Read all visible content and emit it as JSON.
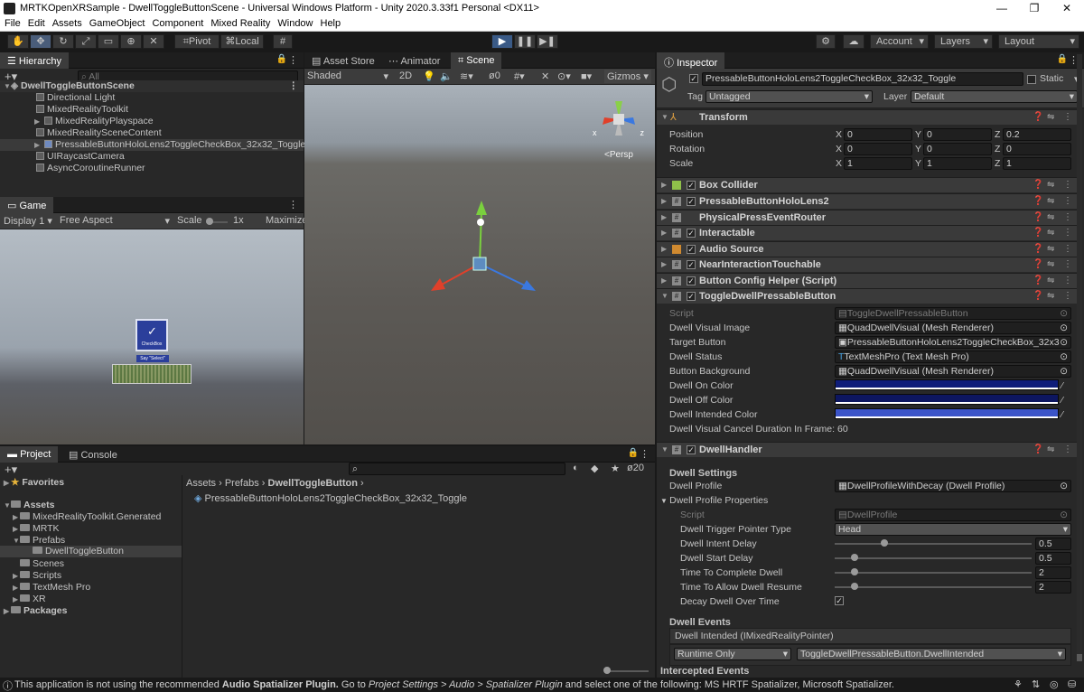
{
  "window": {
    "title": "MRTKOpenXRSample - DwellToggleButtonScene - Universal Windows Platform - Unity 2020.3.33f1 Personal <DX11>",
    "controls": [
      "—",
      "❐",
      "✕"
    ]
  },
  "menu": [
    "File",
    "Edit",
    "Assets",
    "GameObject",
    "Component",
    "Mixed Reality",
    "Window",
    "Help"
  ],
  "toolbar": {
    "pivot": "Pivot",
    "local": "Local",
    "account": "Account",
    "layers": "Layers",
    "layout": "Layout"
  },
  "hierarchy": {
    "tab": "Hierarchy",
    "search_placeholder": "All",
    "scene": "DwellToggleButtonScene",
    "items": [
      "Directional Light",
      "MixedRealityToolkit",
      "MixedRealityPlayspace",
      "MixedRealitySceneContent",
      "PressableButtonHoloLens2ToggleCheckBox_32x32_Toggle",
      "UIRaycastCamera",
      "AsyncCoroutineRunner"
    ]
  },
  "game": {
    "tab": "Game",
    "display": "Display 1",
    "aspect": "Free Aspect",
    "scale_label": "Scale",
    "scale_value": "1x",
    "maximize": "Maximize",
    "button_caption": "CheckBox",
    "say_select": "Say \"Select\""
  },
  "scene": {
    "tabs": [
      "Asset Store",
      "Animator",
      "Scene"
    ],
    "shading": "Shaded",
    "mode_2d": "2D",
    "hidden_count": "0",
    "gizmos": "Gizmos",
    "persp": "<Persp",
    "gizmo_x": "x",
    "gizmo_z": "z"
  },
  "inspector": {
    "tab": "Inspector",
    "object_name": "PressableButtonHoloLens2ToggleCheckBox_32x32_Toggle",
    "static_label": "Static",
    "tag_label": "Tag",
    "tag_value": "Untagged",
    "layer_label": "Layer",
    "layer_value": "Default",
    "transform": {
      "title": "Transform",
      "position_label": "Position",
      "rotation_label": "Rotation",
      "scale_label": "Scale",
      "position": [
        "0",
        "0",
        "0.2"
      ],
      "rotation": [
        "0",
        "0",
        "0"
      ],
      "scale": [
        "1",
        "1",
        "1"
      ],
      "axes": [
        "X",
        "Y",
        "Z"
      ]
    },
    "components": [
      "Box Collider",
      "PressableButtonHoloLens2",
      "PhysicalPressEventRouter",
      "Interactable",
      "Audio Source",
      "NearInteractionTouchable",
      "Button Config Helper (Script)",
      "ToggleDwellPressableButton"
    ],
    "toggle_dwell": {
      "fields": [
        {
          "label": "Script",
          "value": "ToggleDwellPressableButton"
        },
        {
          "label": "Dwell Visual Image",
          "value": "QuadDwellVisual (Mesh Renderer)"
        },
        {
          "label": "Target Button",
          "value": "PressableButtonHoloLens2ToggleCheckBox_32x3"
        },
        {
          "label": "Dwell Status",
          "value": "TextMeshPro (Text Mesh Pro)"
        },
        {
          "label": "Button Background",
          "value": "QuadDwellVisual (Mesh Renderer)"
        }
      ],
      "colors": [
        {
          "label": "Dwell On Color",
          "hex": "#0f1d7a"
        },
        {
          "label": "Dwell Off Color",
          "hex": "#0d1660"
        },
        {
          "label": "Dwell Intended Color",
          "hex": "#3b54c8"
        }
      ],
      "cancel_label": "Dwell Visual Cancel Duration In Frame:",
      "cancel_value": "60"
    },
    "dwell_handler": {
      "title": "DwellHandler",
      "settings_label": "Dwell Settings",
      "profile_label": "Dwell Profile",
      "profile_value": "DwellProfileWithDecay (Dwell Profile)",
      "props_label": "Dwell Profile Properties",
      "script_label": "Script",
      "script_value": "DwellProfile",
      "trigger_label": "Dwell Trigger Pointer Type",
      "trigger_value": "Head",
      "sliders": [
        {
          "label": "Dwell Intent Delay",
          "value": "0.5",
          "fraction": 0.25
        },
        {
          "label": "Dwell Start Delay",
          "value": "0.5",
          "fraction": 0.1
        },
        {
          "label": "Time To Complete Dwell",
          "value": "2",
          "fraction": 0.1
        },
        {
          "label": "Time To Allow Dwell Resume",
          "value": "2",
          "fraction": 0.1
        }
      ],
      "decay_label": "Decay Dwell Over Time",
      "events_label": "Dwell Events",
      "intended_label": "Dwell Intended (IMixedRealityPointer)",
      "runtime_value": "Runtime Only",
      "callback_value": "ToggleDwellPressableButton.DwellIntended",
      "intercepted_label": "Intercepted Events"
    }
  },
  "project": {
    "tabs": [
      "Project",
      "Console"
    ],
    "favorites": "Favorites",
    "assets": "Assets",
    "folders": [
      "MixedRealityToolkit.Generated",
      "MRTK",
      "Prefabs",
      "DwellToggleButton",
      "Scenes",
      "Scripts",
      "TextMesh Pro",
      "XR"
    ],
    "packages": "Packages",
    "breadcrumb": [
      "Assets",
      "Prefabs",
      "DwellToggleButton"
    ],
    "file": "PressableButtonHoloLens2ToggleCheckBox_32x32_Toggle",
    "hidden_count": "20"
  },
  "status": {
    "message_prefix": "This application is not using the recommended ",
    "message_bold": "Audio Spatializer Plugin.",
    "message_mid": " Go to ",
    "message_italic": "Project Settings > Audio > Spatializer Plugin",
    "message_suffix": " and select one of the following: MS HRTF Spatializer, Microsoft Spatializer."
  },
  "colors": {
    "panel": "#282828",
    "play_accent": "#3a5a86",
    "sky": "#9aa3ad",
    "ground": "#5a5855"
  }
}
